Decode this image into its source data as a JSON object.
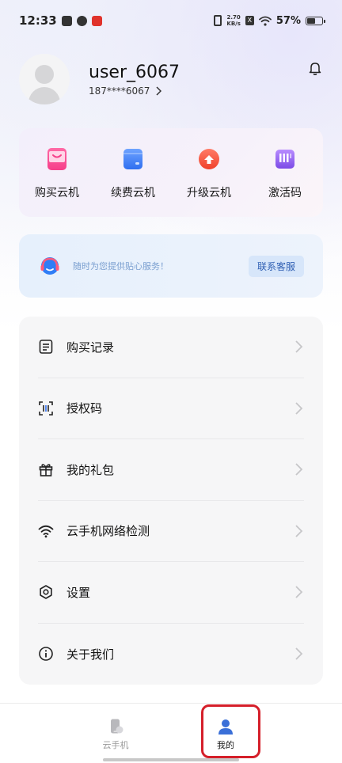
{
  "status_bar": {
    "time": "12:33",
    "net_speed_value": "2.70",
    "net_speed_unit": "KB/s",
    "battery_percent": "57%",
    "battery_level": 0.57,
    "x_badge": "X",
    "icons": [
      "mail-icon",
      "leaf-icon",
      "app-badge-icon",
      "vibrate-icon",
      "wifi-icon",
      "battery-icon"
    ]
  },
  "profile": {
    "username": "user_6067",
    "phone": "187****6067"
  },
  "actions": [
    {
      "label": "购买云机",
      "icon": "shopping-bag-icon"
    },
    {
      "label": "续费云机",
      "icon": "wallet-icon"
    },
    {
      "label": "升级云机",
      "icon": "upgrade-icon"
    },
    {
      "label": "激活码",
      "icon": "activation-code-icon"
    }
  ],
  "service": {
    "text": "随时为您提供贴心服务！",
    "button_label": "联系客服"
  },
  "menu": [
    {
      "label": "购买记录",
      "icon": "document-icon"
    },
    {
      "label": "授权码",
      "icon": "scan-code-icon"
    },
    {
      "label": "我的礼包",
      "icon": "gift-icon"
    },
    {
      "label": "云手机网络检测",
      "icon": "wifi-icon"
    },
    {
      "label": "设置",
      "icon": "gear-icon"
    },
    {
      "label": "关于我们",
      "icon": "info-icon"
    }
  ],
  "bottom_nav": {
    "items": [
      {
        "label": "云手机",
        "active": false
      },
      {
        "label": "我的",
        "active": true
      }
    ]
  },
  "colors": {
    "accent": "#3a6fd8",
    "highlight": "#d51f2a",
    "service_text": "#7a9fd0"
  }
}
